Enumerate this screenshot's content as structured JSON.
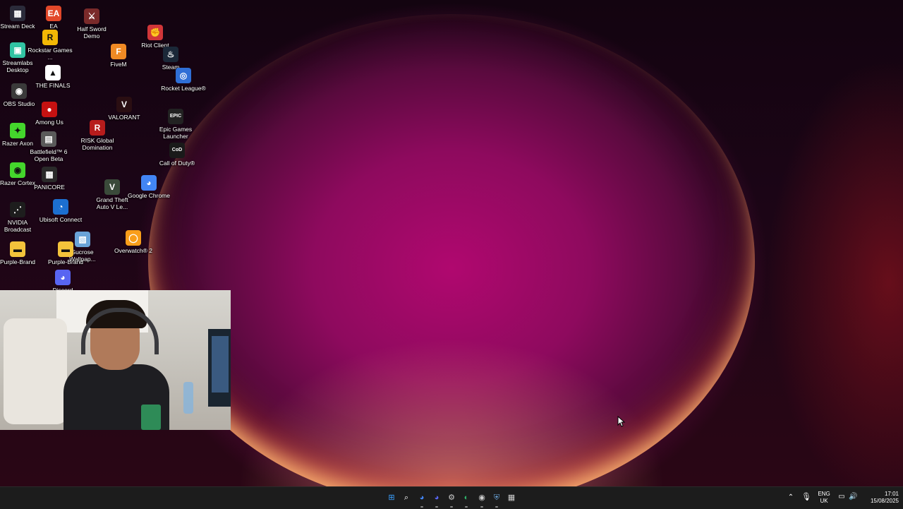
{
  "desktop": {
    "icons": [
      {
        "label": "Stream Deck",
        "icon": "stream-deck-icon",
        "color": "#2b2b3a",
        "glyph": "▦"
      },
      {
        "label": "EA",
        "icon": "ea-icon",
        "color": "#e2482a",
        "glyph": "EA"
      },
      {
        "label": "Half Sword Demo",
        "icon": "half-sword-icon",
        "color": "#7a2a2a",
        "glyph": "⚔"
      },
      {
        "label": "Rockstar Games ...",
        "icon": "rockstar-icon",
        "color": "#f2b705",
        "glyph": "R"
      },
      {
        "label": "Riot Client",
        "icon": "riot-client-icon",
        "color": "#d13639",
        "glyph": "✊"
      },
      {
        "label": "Streamlabs Desktop",
        "icon": "streamlabs-icon",
        "color": "#31c3a2",
        "glyph": "▣"
      },
      {
        "label": "FiveM",
        "icon": "fivem-icon",
        "color": "#f08a24",
        "glyph": "F"
      },
      {
        "label": "Steam",
        "icon": "steam-icon",
        "color": "#1b2838",
        "glyph": "♨"
      },
      {
        "label": "THE FINALS",
        "icon": "the-finals-icon",
        "color": "#ffffff",
        "glyph": "▲"
      },
      {
        "label": "Rocket League®",
        "icon": "rocket-league-icon",
        "color": "#2f6fd6",
        "glyph": "◎"
      },
      {
        "label": "OBS Studio",
        "icon": "obs-icon",
        "color": "#3a3a3a",
        "glyph": "◉"
      },
      {
        "label": "Among Us",
        "icon": "among-us-icon",
        "color": "#c51111",
        "glyph": "●"
      },
      {
        "label": "VALORANT",
        "icon": "valorant-icon",
        "color": "#2a0e12",
        "glyph": "V"
      },
      {
        "label": "Epic Games Launcher",
        "icon": "epic-games-icon",
        "color": "#222222",
        "glyph": "EPIC"
      },
      {
        "label": "Razer Axon",
        "icon": "razer-axon-icon",
        "color": "#44d62c",
        "glyph": "✦"
      },
      {
        "label": "Battlefield™ 6 Open Beta",
        "icon": "battlefield-icon",
        "color": "#5a5a5a",
        "glyph": "▤"
      },
      {
        "label": "RISK Global Domination",
        "icon": "risk-icon",
        "color": "#b71c1c",
        "glyph": "R"
      },
      {
        "label": "Call of Duty®",
        "icon": "call-of-duty-icon",
        "color": "#1a1a1a",
        "glyph": "CoD"
      },
      {
        "label": "Razer Cortex",
        "icon": "razer-cortex-icon",
        "color": "#44d62c",
        "glyph": "◉"
      },
      {
        "label": "PANICORE",
        "icon": "panicore-icon",
        "color": "#2a2a2a",
        "glyph": "▦"
      },
      {
        "label": "Grand Theft Auto V Le...",
        "icon": "gta-v-icon",
        "color": "#3a4a3a",
        "glyph": "V"
      },
      {
        "label": "Google Chrome",
        "icon": "chrome-icon",
        "color": "#4285f4",
        "glyph": "◕"
      },
      {
        "label": "NVIDIA Broadcast",
        "icon": "nvidia-broadcast-icon",
        "color": "#1d1d1d",
        "glyph": "⋰"
      },
      {
        "label": "Ubisoft Connect",
        "icon": "ubisoft-icon",
        "color": "#1c6fd0",
        "glyph": "◔"
      },
      {
        "label": "Sucrose Wallpap...",
        "icon": "sucrose-icon",
        "color": "#6aa3d8",
        "glyph": "▧"
      },
      {
        "label": "Overwatch® 2",
        "icon": "overwatch-icon",
        "color": "#f99e1a",
        "glyph": "◯"
      },
      {
        "label": "Purple-Brand",
        "icon": "folder-icon",
        "color": "#f3c33b",
        "glyph": "▬"
      },
      {
        "label": "Purple-Brand",
        "icon": "folder-icon",
        "color": "#f3c33b",
        "glyph": "▬"
      },
      {
        "label": "Discord",
        "icon": "discord-icon",
        "color": "#5865f2",
        "glyph": "◕"
      }
    ]
  },
  "webcam": {
    "description_icon": "webcam-overlay"
  },
  "taskbar": {
    "apps": [
      {
        "name": "start",
        "icon": "windows-start-icon",
        "glyph": "⊞",
        "color": "#3aa0ff"
      },
      {
        "name": "search",
        "icon": "search-icon",
        "glyph": "⌕",
        "color": "#ffffff"
      },
      {
        "name": "chrome",
        "icon": "chrome-icon",
        "glyph": "◕",
        "color": "#4285f4"
      },
      {
        "name": "discord",
        "icon": "discord-icon",
        "glyph": "◕",
        "color": "#5865f2"
      },
      {
        "name": "settings",
        "icon": "gear-icon",
        "glyph": "⚙",
        "color": "#cccccc"
      },
      {
        "name": "edge",
        "icon": "edge-icon",
        "glyph": "◐",
        "color": "#2fb36b"
      },
      {
        "name": "obs",
        "icon": "obs-icon",
        "glyph": "◉",
        "color": "#cccccc"
      },
      {
        "name": "defender",
        "icon": "shield-icon",
        "glyph": "⛨",
        "color": "#6aa3d8"
      },
      {
        "name": "nvidia",
        "icon": "nvidia-icon",
        "glyph": "▦",
        "color": "#cccccc"
      }
    ],
    "tray": {
      "language_line1": "ENG",
      "language_line2": "UK",
      "time": "17:01",
      "date": "15/08/2025"
    }
  }
}
